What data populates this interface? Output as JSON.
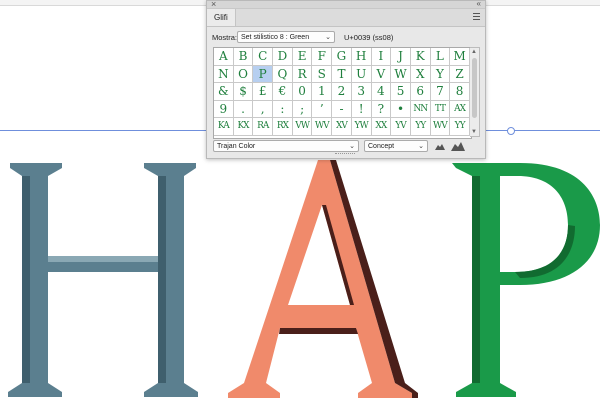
{
  "panel": {
    "tab_label": "Glifi",
    "show_label": "Mostra:",
    "show_value": "Set stilistico 8 : Green",
    "unicode": "U+0039 (ss08)",
    "font_name": "Trajan Color",
    "font_style": "Concept",
    "glyph_color": "#1f7f3d",
    "selected_color": "#b7cff0",
    "glyph_rows": [
      [
        "A",
        "B",
        "C",
        "D",
        "E",
        "F",
        "G",
        "H",
        "I",
        "J",
        "K",
        "L",
        "M"
      ],
      [
        "N",
        "O",
        "P",
        "Q",
        "R",
        "S",
        "T",
        "U",
        "V",
        "W",
        "X",
        "Y",
        "Z"
      ],
      [
        "&",
        "$",
        "£",
        "€",
        "0",
        "1",
        "2",
        "3",
        "4",
        "5",
        "6",
        "7",
        "8"
      ],
      [
        "9",
        ".",
        ",",
        ":",
        ";",
        "’",
        "-",
        "!",
        "?",
        "•",
        "NN",
        "TT",
        "AX"
      ],
      [
        "KA",
        "KX",
        "RA",
        "RX",
        "VW",
        "WV",
        "XV",
        "YW",
        "XX",
        "YV",
        "YY",
        "WV",
        "YY"
      ]
    ],
    "selected_glyph": "P",
    "icons": [
      "close-icon",
      "collapse-icon",
      "panel-menu-icon",
      "chevron-down-icon",
      "zoom-out-icon",
      "zoom-in-icon"
    ]
  },
  "canvas": {
    "letters": [
      "H",
      "A",
      "P"
    ],
    "letter_colors": {
      "H": "#5b7f8f",
      "A": "#f08a6b",
      "P": "#1a9a49"
    },
    "guide_color": "#6f8fdc"
  }
}
